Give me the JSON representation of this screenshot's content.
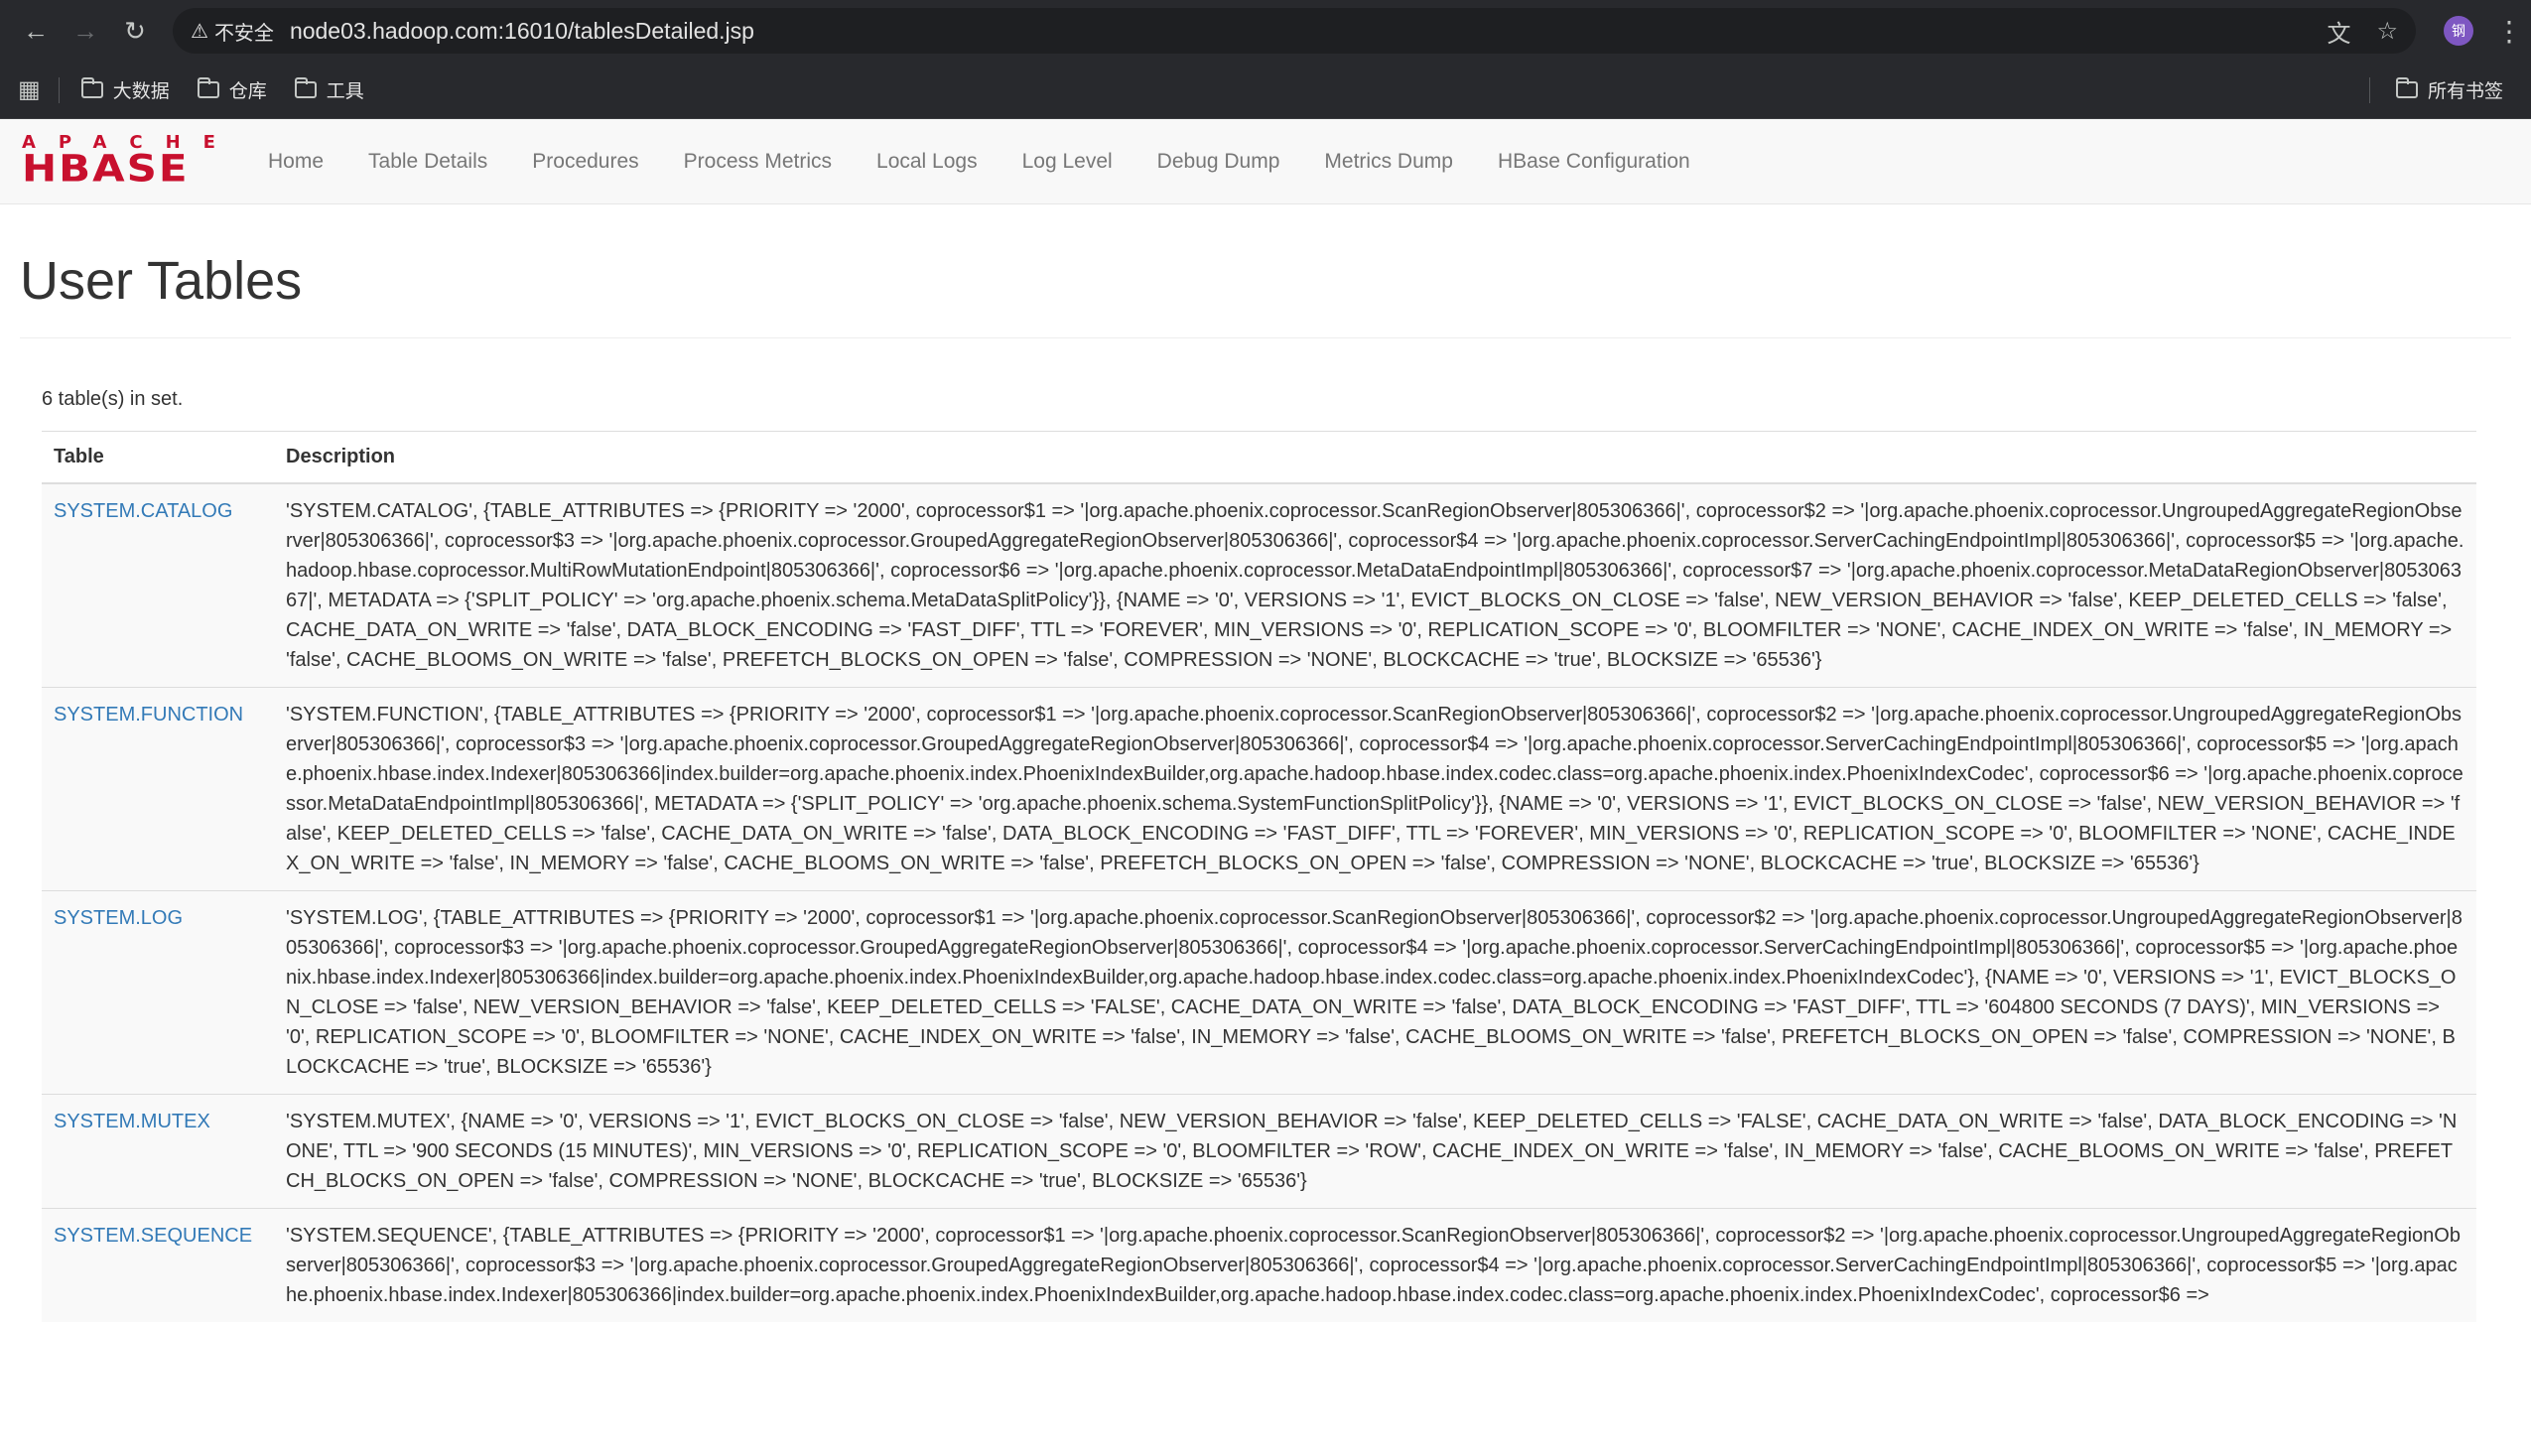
{
  "browser": {
    "security_label": "不安全",
    "url": "node03.hadoop.com:16010/tablesDetailed.jsp",
    "profile_initial": "钢",
    "bookmarks": [
      "大数据",
      "仓库",
      "工具"
    ],
    "all_bookmarks": "所有书签"
  },
  "logo": {
    "top": "APACHE",
    "bottom": "HBASE"
  },
  "nav": [
    "Home",
    "Table Details",
    "Procedures",
    "Process Metrics",
    "Local Logs",
    "Log Level",
    "Debug Dump",
    "Metrics Dump",
    "HBase Configuration"
  ],
  "page": {
    "title": "User Tables",
    "count_text": "6 table(s) in set.",
    "columns": [
      "Table",
      "Description"
    ]
  },
  "tables": [
    {
      "name": "SYSTEM.CATALOG",
      "description": "'SYSTEM.CATALOG', {TABLE_ATTRIBUTES => {PRIORITY => '2000', coprocessor$1 => '|org.apache.phoenix.coprocessor.ScanRegionObserver|805306366|', coprocessor$2 => '|org.apache.phoenix.coprocessor.UngroupedAggregateRegionObserver|805306366|', coprocessor$3 => '|org.apache.phoenix.coprocessor.GroupedAggregateRegionObserver|805306366|', coprocessor$4 => '|org.apache.phoenix.coprocessor.ServerCachingEndpointImpl|805306366|', coprocessor$5 => '|org.apache.hadoop.hbase.coprocessor.MultiRowMutationEndpoint|805306366|', coprocessor$6 => '|org.apache.phoenix.coprocessor.MetaDataEndpointImpl|805306366|', coprocessor$7 => '|org.apache.phoenix.coprocessor.MetaDataRegionObserver|805306367|', METADATA => {'SPLIT_POLICY' => 'org.apache.phoenix.schema.MetaDataSplitPolicy'}}, {NAME => '0', VERSIONS => '1', EVICT_BLOCKS_ON_CLOSE => 'false', NEW_VERSION_BEHAVIOR => 'false', KEEP_DELETED_CELLS => 'false', CACHE_DATA_ON_WRITE => 'false', DATA_BLOCK_ENCODING => 'FAST_DIFF', TTL => 'FOREVER', MIN_VERSIONS => '0', REPLICATION_SCOPE => '0', BLOOMFILTER => 'NONE', CACHE_INDEX_ON_WRITE => 'false', IN_MEMORY => 'false', CACHE_BLOOMS_ON_WRITE => 'false', PREFETCH_BLOCKS_ON_OPEN => 'false', COMPRESSION => 'NONE', BLOCKCACHE => 'true', BLOCKSIZE => '65536'}"
    },
    {
      "name": "SYSTEM.FUNCTION",
      "description": "'SYSTEM.FUNCTION', {TABLE_ATTRIBUTES => {PRIORITY => '2000', coprocessor$1 => '|org.apache.phoenix.coprocessor.ScanRegionObserver|805306366|', coprocessor$2 => '|org.apache.phoenix.coprocessor.UngroupedAggregateRegionObserver|805306366|', coprocessor$3 => '|org.apache.phoenix.coprocessor.GroupedAggregateRegionObserver|805306366|', coprocessor$4 => '|org.apache.phoenix.coprocessor.ServerCachingEndpointImpl|805306366|', coprocessor$5 => '|org.apache.phoenix.hbase.index.Indexer|805306366|index.builder=org.apache.phoenix.index.PhoenixIndexBuilder,org.apache.hadoop.hbase.index.codec.class=org.apache.phoenix.index.PhoenixIndexCodec', coprocessor$6 => '|org.apache.phoenix.coprocessor.MetaDataEndpointImpl|805306366|', METADATA => {'SPLIT_POLICY' => 'org.apache.phoenix.schema.SystemFunctionSplitPolicy'}}, {NAME => '0', VERSIONS => '1', EVICT_BLOCKS_ON_CLOSE => 'false', NEW_VERSION_BEHAVIOR => 'false', KEEP_DELETED_CELLS => 'false', CACHE_DATA_ON_WRITE => 'false', DATA_BLOCK_ENCODING => 'FAST_DIFF', TTL => 'FOREVER', MIN_VERSIONS => '0', REPLICATION_SCOPE => '0', BLOOMFILTER => 'NONE', CACHE_INDEX_ON_WRITE => 'false', IN_MEMORY => 'false', CACHE_BLOOMS_ON_WRITE => 'false', PREFETCH_BLOCKS_ON_OPEN => 'false', COMPRESSION => 'NONE', BLOCKCACHE => 'true', BLOCKSIZE => '65536'}"
    },
    {
      "name": "SYSTEM.LOG",
      "description": "'SYSTEM.LOG', {TABLE_ATTRIBUTES => {PRIORITY => '2000', coprocessor$1 => '|org.apache.phoenix.coprocessor.ScanRegionObserver|805306366|', coprocessor$2 => '|org.apache.phoenix.coprocessor.UngroupedAggregateRegionObserver|805306366|', coprocessor$3 => '|org.apache.phoenix.coprocessor.GroupedAggregateRegionObserver|805306366|', coprocessor$4 => '|org.apache.phoenix.coprocessor.ServerCachingEndpointImpl|805306366|', coprocessor$5 => '|org.apache.phoenix.hbase.index.Indexer|805306366|index.builder=org.apache.phoenix.index.PhoenixIndexBuilder,org.apache.hadoop.hbase.index.codec.class=org.apache.phoenix.index.PhoenixIndexCodec'}, {NAME => '0', VERSIONS => '1', EVICT_BLOCKS_ON_CLOSE => 'false', NEW_VERSION_BEHAVIOR => 'false', KEEP_DELETED_CELLS => 'FALSE', CACHE_DATA_ON_WRITE => 'false', DATA_BLOCK_ENCODING => 'FAST_DIFF', TTL => '604800 SECONDS (7 DAYS)', MIN_VERSIONS => '0', REPLICATION_SCOPE => '0', BLOOMFILTER => 'NONE', CACHE_INDEX_ON_WRITE => 'false', IN_MEMORY => 'false', CACHE_BLOOMS_ON_WRITE => 'false', PREFETCH_BLOCKS_ON_OPEN => 'false', COMPRESSION => 'NONE', BLOCKCACHE => 'true', BLOCKSIZE => '65536'}"
    },
    {
      "name": "SYSTEM.MUTEX",
      "description": "'SYSTEM.MUTEX', {NAME => '0', VERSIONS => '1', EVICT_BLOCKS_ON_CLOSE => 'false', NEW_VERSION_BEHAVIOR => 'false', KEEP_DELETED_CELLS => 'FALSE', CACHE_DATA_ON_WRITE => 'false', DATA_BLOCK_ENCODING => 'NONE', TTL => '900 SECONDS (15 MINUTES)', MIN_VERSIONS => '0', REPLICATION_SCOPE => '0', BLOOMFILTER => 'ROW', CACHE_INDEX_ON_WRITE => 'false', IN_MEMORY => 'false', CACHE_BLOOMS_ON_WRITE => 'false', PREFETCH_BLOCKS_ON_OPEN => 'false', COMPRESSION => 'NONE', BLOCKCACHE => 'true', BLOCKSIZE => '65536'}"
    },
    {
      "name": "SYSTEM.SEQUENCE",
      "description": "'SYSTEM.SEQUENCE', {TABLE_ATTRIBUTES => {PRIORITY => '2000', coprocessor$1 => '|org.apache.phoenix.coprocessor.ScanRegionObserver|805306366|', coprocessor$2 => '|org.apache.phoenix.coprocessor.UngroupedAggregateRegionObserver|805306366|', coprocessor$3 => '|org.apache.phoenix.coprocessor.GroupedAggregateRegionObserver|805306366|', coprocessor$4 => '|org.apache.phoenix.coprocessor.ServerCachingEndpointImpl|805306366|', coprocessor$5 => '|org.apache.phoenix.hbase.index.Indexer|805306366|index.builder=org.apache.phoenix.index.PhoenixIndexBuilder,org.apache.hadoop.hbase.index.codec.class=org.apache.phoenix.index.PhoenixIndexCodec', coprocessor$6 =>"
    }
  ]
}
